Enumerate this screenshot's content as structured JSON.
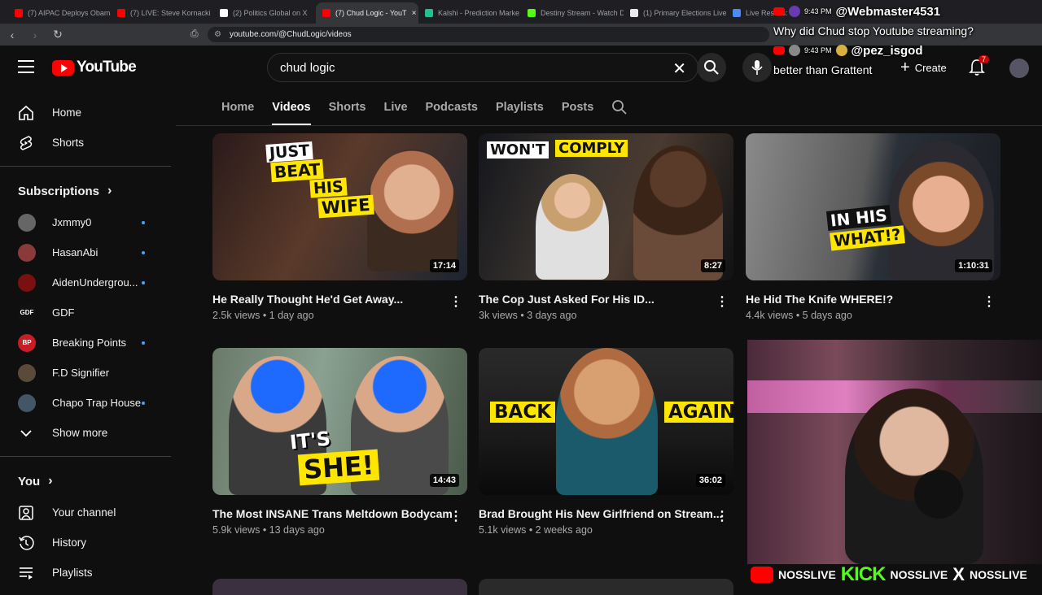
{
  "browser": {
    "tabs": [
      {
        "label": "(7) AIPAC Deploys Obama",
        "color": "#ff0000"
      },
      {
        "label": "(7) LIVE: Steve Kornacki",
        "color": "#ff0000"
      },
      {
        "label": "(2) Politics Global on X",
        "color": "#ffffff"
      },
      {
        "label": "(7) Chud Logic - YouT",
        "color": "#ff0000"
      },
      {
        "label": "Kalshi - Prediction Marke",
        "color": "#21c08e"
      },
      {
        "label": "Destiny Stream - Watch D",
        "color": "#53fc18"
      },
      {
        "label": "(1) Primary Elections Live",
        "color": "#e8eaed"
      },
      {
        "label": "Live Results: ",
        "color": "#4c8bf5"
      }
    ],
    "url": "youtube.com/@ChudLogic/videos"
  },
  "header": {
    "logo_text": "YouTube",
    "search_value": "chud logic",
    "create_label": "Create",
    "notification_count": "7"
  },
  "sidebar": {
    "main": [
      {
        "label": "Home",
        "icon": "home-icon"
      },
      {
        "label": "Shorts",
        "icon": "shorts-icon"
      }
    ],
    "subscriptions_title": "Subscriptions",
    "subscriptions": [
      {
        "label": "Jxmmy0",
        "color": "#666666",
        "initials": "",
        "new": true
      },
      {
        "label": "HasanAbi",
        "color": "#8a3a3a",
        "initials": "",
        "new": true
      },
      {
        "label": "AidenUndergrou...",
        "color": "#7a1010",
        "initials": "",
        "new": true
      },
      {
        "label": "GDF",
        "color": "#111111",
        "initials": "GDF",
        "new": false
      },
      {
        "label": "Breaking Points",
        "color": "#c81d25",
        "initials": "BP",
        "new": true
      },
      {
        "label": "F.D Signifier",
        "color": "#5a4a3a",
        "initials": "",
        "new": false
      },
      {
        "label": "Chapo Trap House",
        "color": "#445566",
        "initials": "",
        "new": true
      }
    ],
    "show_more": "Show more",
    "you_title": "You",
    "you_items": [
      {
        "label": "Your channel",
        "icon": "your-channel-icon"
      },
      {
        "label": "History",
        "icon": "history-icon"
      },
      {
        "label": "Playlists",
        "icon": "playlists-icon"
      }
    ]
  },
  "channel_tabs": [
    "Home",
    "Videos",
    "Shorts",
    "Live",
    "Podcasts",
    "Playlists",
    "Posts"
  ],
  "videos": [
    {
      "title": "He Really Thought He'd Get Away...",
      "meta": "2.5k views • 1 day ago",
      "duration": "17:14",
      "overlay": [
        "JUST",
        "BEAT",
        "HIS",
        "WIFE"
      ]
    },
    {
      "title": "The Cop Just Asked For His ID...",
      "meta": "3k views • 3 days ago",
      "duration": "8:27",
      "overlay": [
        "WON'T",
        "COMPLY"
      ]
    },
    {
      "title": "He Hid The Knife WHERE!?",
      "meta": "4.4k views • 5 days ago",
      "duration": "1:10:31",
      "overlay": [
        "IN HIS",
        "WHAT!?"
      ]
    },
    {
      "title": "The Most INSANE Trans Meltdown Bodycam",
      "meta": "5.9k views • 13 days ago",
      "duration": "14:43",
      "overlay": [
        "IT'S",
        "SHE!"
      ]
    },
    {
      "title": "Brad Brought His New Girlfriend on Stream...",
      "meta": "5.1k views • 2 weeks ago",
      "duration": "36:02",
      "overlay": [
        "BACK",
        "AGAIN"
      ]
    }
  ],
  "stream_chat": [
    {
      "time": "9:43 PM",
      "user": "@Webmaster4531",
      "message": "Why did Chud stop Youtube streaming?"
    },
    {
      "time": "9:43 PM",
      "user": "@pez_isgod",
      "message": "better than Grattent"
    }
  ],
  "stream_bar": {
    "handle1": "NOSSLIVE",
    "kick": "KICK",
    "handle2": "NOSSLIVE",
    "x": "X",
    "handle3": "NOSSLIVE"
  }
}
